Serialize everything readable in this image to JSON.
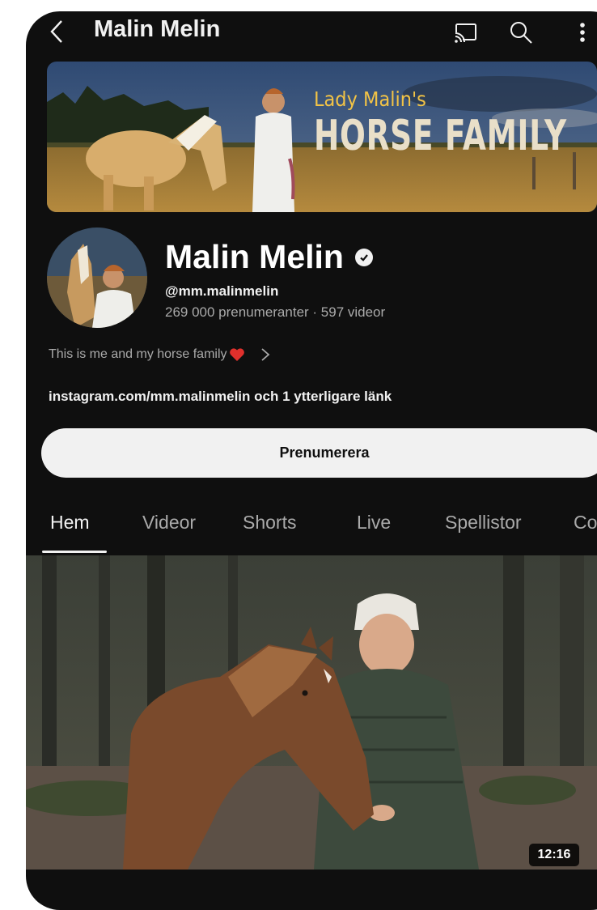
{
  "header": {
    "title": "Malin Melin",
    "icons": [
      "back-chevron-icon",
      "cast-icon",
      "search-icon",
      "more-vert-icon"
    ]
  },
  "banner": {
    "line1": "Lady Malin's",
    "line2": "HORSE FAMILY"
  },
  "channel": {
    "name": "Malin Melin",
    "handle": "@mm.malinmelin",
    "stats": "269 000 prenumeranter · 597 videor",
    "description": "This is me and my horse family",
    "links": "instagram.com/mm.malinmelin och 1 ytterligare länk"
  },
  "subscribe_label": "Prenumerera",
  "tabs": [
    {
      "label": "Hem",
      "active": true
    },
    {
      "label": "Videor"
    },
    {
      "label": "Shorts"
    },
    {
      "label": "Live"
    },
    {
      "label": "Spellistor"
    },
    {
      "label": "Co"
    }
  ],
  "video": {
    "duration": "12:16"
  },
  "colors": {
    "background": "#0f0f0f",
    "text_primary": "#f1f1f1",
    "text_secondary": "#aaaaaa",
    "banner_accent": "#f2c346"
  }
}
